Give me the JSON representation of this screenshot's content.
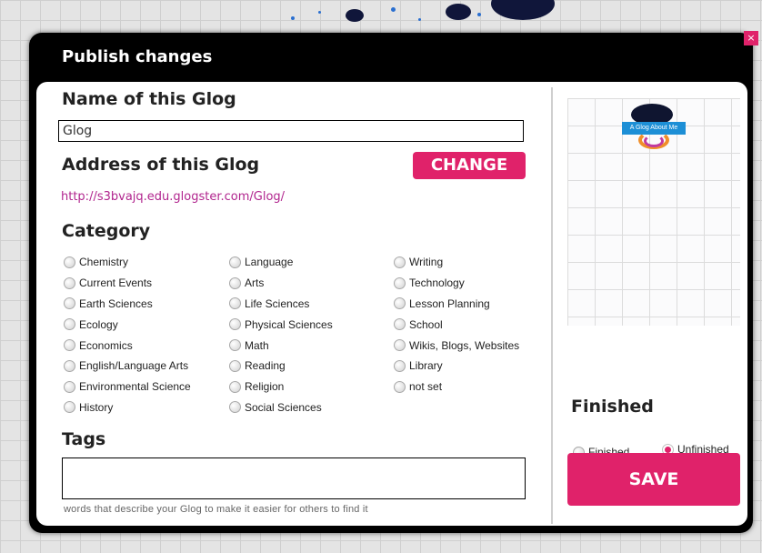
{
  "modal": {
    "title": "Publish changes",
    "close_label": "×"
  },
  "name_section": {
    "heading": "Name of this Glog",
    "value": "Glog"
  },
  "address_section": {
    "heading": "Address of this Glog",
    "change_label": "CHANGE",
    "url": "http://s3bvajq.edu.glogster.com/Glog/"
  },
  "category": {
    "heading": "Category",
    "columns": [
      [
        "Chemistry",
        "Current Events",
        "Earth Sciences",
        "Ecology",
        "Economics",
        "English/Language Arts",
        "Environmental Science",
        "History"
      ],
      [
        "Language",
        "Arts",
        "Life Sciences",
        "Physical Sciences",
        "Math",
        "Reading",
        "Religion",
        "Social Sciences"
      ],
      [
        "Writing",
        "Technology",
        "Lesson Planning",
        "School",
        "Wikis, Blogs, Websites",
        "Library",
        "not set"
      ]
    ]
  },
  "tags": {
    "heading": "Tags",
    "hint": "words that describe your Glog to make it easier for others to find it"
  },
  "preview": {
    "banner_text": "A Glog About Me"
  },
  "finished": {
    "heading": "Finished",
    "options": [
      "Finished",
      "Unfinished"
    ],
    "selected": "Unfinished"
  },
  "save_label": "SAVE",
  "colors": {
    "accent": "#e0226a",
    "link": "#b1258e"
  }
}
